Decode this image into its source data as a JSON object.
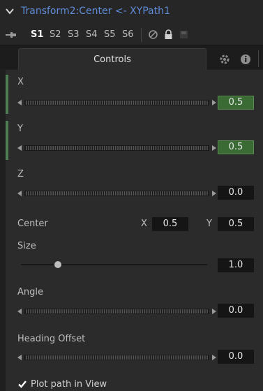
{
  "header": {
    "title": "Transform2:Center <- XYPath1",
    "chevron_icon": "chevron-down-icon"
  },
  "toolbar": {
    "pin_icon": "pin-icon",
    "slots": [
      "S1",
      "S2",
      "S3",
      "S4",
      "S5",
      "S6"
    ],
    "active_slot": "S1",
    "icons": [
      "disable-icon",
      "lock-icon",
      "save-icon"
    ]
  },
  "tabs": {
    "controls_label": "Controls",
    "icons": [
      "gear-icon",
      "info-icon"
    ]
  },
  "controls": {
    "x_label": "X",
    "x_value": "0.5",
    "y_label": "Y",
    "y_value": "0.5",
    "z_label": "Z",
    "z_value": "0.0",
    "center_label": "Center",
    "center_x_label": "X",
    "center_x_value": "0.5",
    "center_y_label": "Y",
    "center_y_value": "0.5",
    "size_label": "Size",
    "size_value": "1.0",
    "size_slider_fraction": 0.2,
    "angle_label": "Angle",
    "angle_value": "0.0",
    "heading_label": "Heading Offset",
    "heading_value": "0.0",
    "plot_path_label": "Plot path in View",
    "plot_path_checked": true
  },
  "colors": {
    "accent": "#5f8bd7",
    "group_bar": "#4f7d54",
    "field_active": "#3b6b35"
  }
}
